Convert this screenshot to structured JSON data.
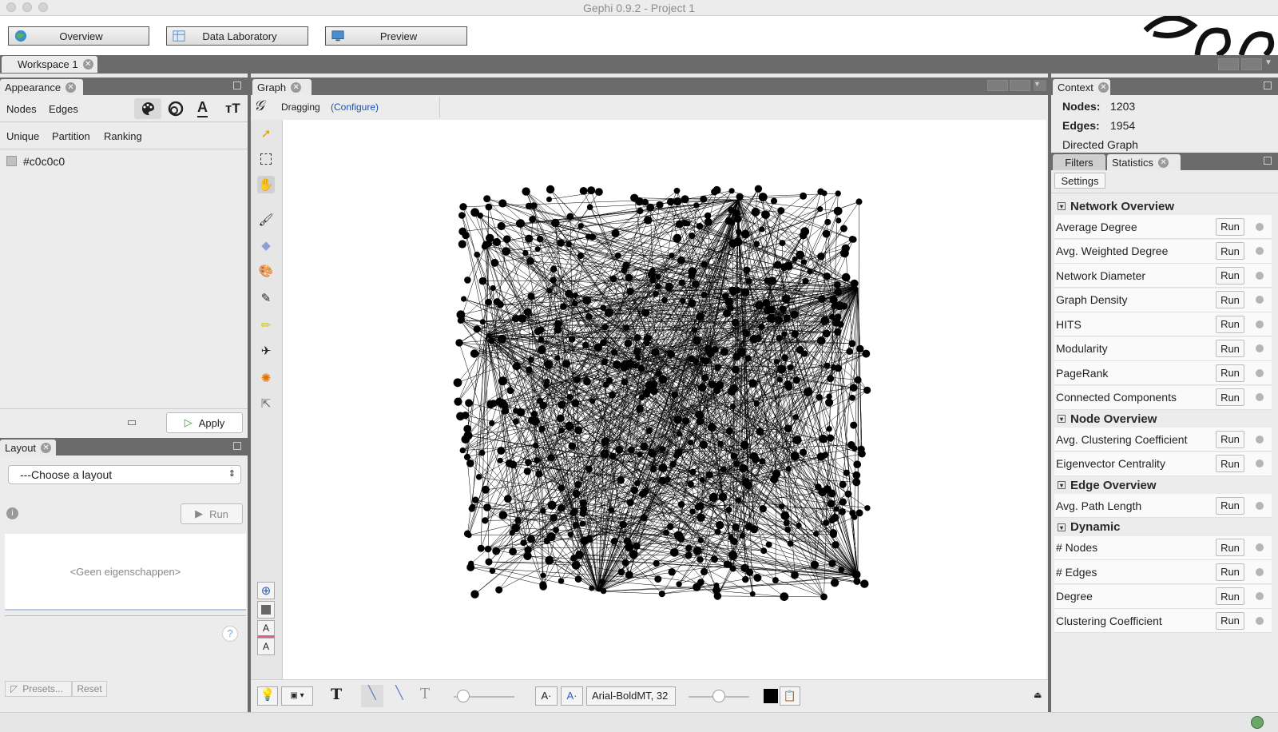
{
  "window": {
    "title": "Gephi 0.9.2 - Project 1"
  },
  "toolbar": {
    "overview": "Overview",
    "data_laboratory": "Data Laboratory",
    "preview": "Preview"
  },
  "workspace": {
    "tab": "Workspace 1"
  },
  "appearance": {
    "title": "Appearance",
    "tabs": [
      "Nodes",
      "Edges"
    ],
    "modes": [
      "Unique",
      "Partition",
      "Ranking"
    ],
    "color_value": "#c0c0c0",
    "color_swatch": "#c0c0c0",
    "apply": "Apply"
  },
  "layout": {
    "title": "Layout",
    "select": "---Choose a layout",
    "run": "Run",
    "properties_empty": "<Geen eigenschappen>",
    "help": "?",
    "presets": "Presets...",
    "reset": "Reset"
  },
  "graph": {
    "title": "Graph",
    "mode": "Dragging",
    "configure": "(Configure)",
    "font": "Arial-BoldMT, 32",
    "node_color": "#000000",
    "edge_color": "#000000"
  },
  "context": {
    "title": "Context",
    "nodes_label": "Nodes:",
    "nodes_value": "1203",
    "edges_label": "Edges:",
    "edges_value": "1954",
    "graph_type": "Directed Graph"
  },
  "stats": {
    "tab_filters": "Filters",
    "tab_statistics": "Statistics",
    "settings": "Settings",
    "run": "Run",
    "sections": [
      {
        "name": "Network Overview",
        "items": [
          "Average Degree",
          "Avg. Weighted Degree",
          "Network Diameter",
          "Graph Density",
          "HITS",
          "Modularity",
          "PageRank",
          "Connected Components"
        ]
      },
      {
        "name": "Node Overview",
        "items": [
          "Avg. Clustering Coefficient",
          "Eigenvector Centrality"
        ]
      },
      {
        "name": "Edge Overview",
        "items": [
          "Avg. Path Length"
        ]
      },
      {
        "name": "Dynamic",
        "items": [
          "# Nodes",
          "# Edges",
          "Degree",
          "Clustering Coefficient"
        ]
      }
    ]
  }
}
